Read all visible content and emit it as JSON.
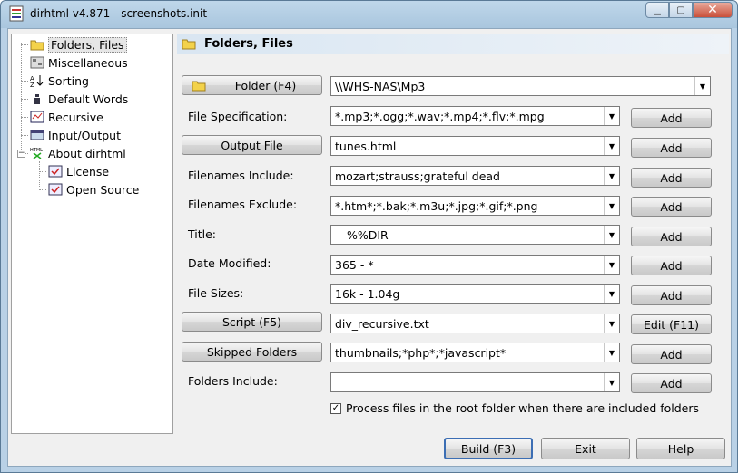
{
  "window": {
    "title": "dirhtml v4.871 - screenshots.init"
  },
  "tree": {
    "items": [
      {
        "label": "Folders, Files",
        "icon": "folder-icon"
      },
      {
        "label": "Miscellaneous",
        "icon": "misc-icon"
      },
      {
        "label": "Sorting",
        "icon": "sort-icon"
      },
      {
        "label": "Default Words",
        "icon": "words-icon"
      },
      {
        "label": "Recursive",
        "icon": "recursive-icon"
      },
      {
        "label": "Input/Output",
        "icon": "io-icon"
      },
      {
        "label": "About dirhtml",
        "icon": "html-icon"
      },
      {
        "label": "License",
        "icon": "license-icon"
      },
      {
        "label": "Open Source",
        "icon": "opensource-icon"
      }
    ]
  },
  "panel": {
    "title": "Folders, Files"
  },
  "fields": {
    "folder": {
      "button": "Folder (F4)",
      "value": "\\\\WHS-NAS\\Mp3"
    },
    "filespec": {
      "label": "File Specification:",
      "value": "*.mp3;*.ogg;*.wav;*.mp4;*.flv;*.mpg",
      "add": "Add"
    },
    "output": {
      "button": "Output File",
      "value": "tunes.html",
      "add": "Add"
    },
    "include": {
      "label": "Filenames Include:",
      "value": "mozart;strauss;grateful dead",
      "add": "Add"
    },
    "exclude": {
      "label": "Filenames Exclude:",
      "value": "*.htm*;*.bak;*.m3u;*.jpg;*.gif;*.png",
      "add": "Add"
    },
    "title": {
      "label": "Title:",
      "value": "-- %%DIR --",
      "add": "Add"
    },
    "modified": {
      "label": "Date Modified:",
      "value": "365 - *",
      "add": "Add"
    },
    "sizes": {
      "label": "File Sizes:",
      "value": "16k - 1.04g",
      "add": "Add"
    },
    "script": {
      "button": "Script (F5)",
      "value": "div_recursive.txt",
      "edit": "Edit (F11)"
    },
    "skipped": {
      "button": "Skipped Folders",
      "value": "thumbnails;*php*;*javascript*",
      "add": "Add"
    },
    "foldersinc": {
      "label": "Folders Include:",
      "value": "",
      "add": "Add"
    }
  },
  "checkbox": {
    "label": "Process files in the root folder when there are included folders",
    "checked": true
  },
  "buttons": {
    "build": "Build (F3)",
    "exit": "Exit",
    "help": "Help"
  }
}
